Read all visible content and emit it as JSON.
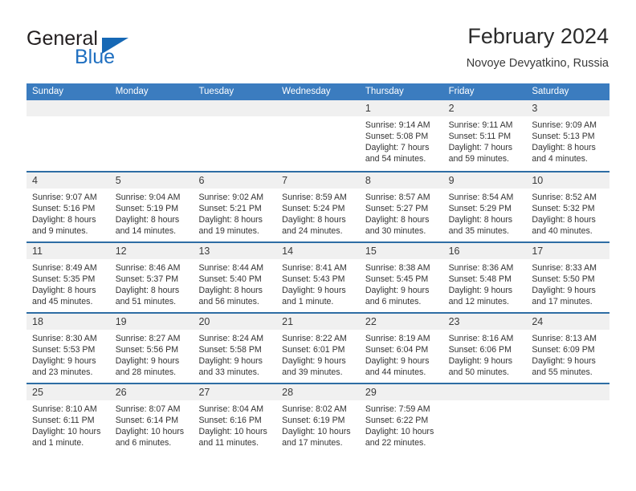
{
  "brand": {
    "word_one": "General",
    "word_two": "Blue",
    "triangle_color": "#1668b5"
  },
  "header": {
    "title": "February 2024",
    "subtitle": "Novoye Devyatkino, Russia"
  },
  "theme": {
    "header_row_bg": "#3b7cbf",
    "row_divider": "#2e6da4",
    "day_band_bg": "#f0f0f0",
    "text": "#333333"
  },
  "weekdays": [
    "Sunday",
    "Monday",
    "Tuesday",
    "Wednesday",
    "Thursday",
    "Friday",
    "Saturday"
  ],
  "weeks": [
    [
      {
        "day": "",
        "lines": [
          "",
          "",
          "",
          ""
        ]
      },
      {
        "day": "",
        "lines": [
          "",
          "",
          "",
          ""
        ]
      },
      {
        "day": "",
        "lines": [
          "",
          "",
          "",
          ""
        ]
      },
      {
        "day": "",
        "lines": [
          "",
          "",
          "",
          ""
        ]
      },
      {
        "day": "1",
        "lines": [
          "Sunrise: 9:14 AM",
          "Sunset: 5:08 PM",
          "Daylight: 7 hours",
          "and 54 minutes."
        ]
      },
      {
        "day": "2",
        "lines": [
          "Sunrise: 9:11 AM",
          "Sunset: 5:11 PM",
          "Daylight: 7 hours",
          "and 59 minutes."
        ]
      },
      {
        "day": "3",
        "lines": [
          "Sunrise: 9:09 AM",
          "Sunset: 5:13 PM",
          "Daylight: 8 hours",
          "and 4 minutes."
        ]
      }
    ],
    [
      {
        "day": "4",
        "lines": [
          "Sunrise: 9:07 AM",
          "Sunset: 5:16 PM",
          "Daylight: 8 hours",
          "and 9 minutes."
        ]
      },
      {
        "day": "5",
        "lines": [
          "Sunrise: 9:04 AM",
          "Sunset: 5:19 PM",
          "Daylight: 8 hours",
          "and 14 minutes."
        ]
      },
      {
        "day": "6",
        "lines": [
          "Sunrise: 9:02 AM",
          "Sunset: 5:21 PM",
          "Daylight: 8 hours",
          "and 19 minutes."
        ]
      },
      {
        "day": "7",
        "lines": [
          "Sunrise: 8:59 AM",
          "Sunset: 5:24 PM",
          "Daylight: 8 hours",
          "and 24 minutes."
        ]
      },
      {
        "day": "8",
        "lines": [
          "Sunrise: 8:57 AM",
          "Sunset: 5:27 PM",
          "Daylight: 8 hours",
          "and 30 minutes."
        ]
      },
      {
        "day": "9",
        "lines": [
          "Sunrise: 8:54 AM",
          "Sunset: 5:29 PM",
          "Daylight: 8 hours",
          "and 35 minutes."
        ]
      },
      {
        "day": "10",
        "lines": [
          "Sunrise: 8:52 AM",
          "Sunset: 5:32 PM",
          "Daylight: 8 hours",
          "and 40 minutes."
        ]
      }
    ],
    [
      {
        "day": "11",
        "lines": [
          "Sunrise: 8:49 AM",
          "Sunset: 5:35 PM",
          "Daylight: 8 hours",
          "and 45 minutes."
        ]
      },
      {
        "day": "12",
        "lines": [
          "Sunrise: 8:46 AM",
          "Sunset: 5:37 PM",
          "Daylight: 8 hours",
          "and 51 minutes."
        ]
      },
      {
        "day": "13",
        "lines": [
          "Sunrise: 8:44 AM",
          "Sunset: 5:40 PM",
          "Daylight: 8 hours",
          "and 56 minutes."
        ]
      },
      {
        "day": "14",
        "lines": [
          "Sunrise: 8:41 AM",
          "Sunset: 5:43 PM",
          "Daylight: 9 hours",
          "and 1 minute."
        ]
      },
      {
        "day": "15",
        "lines": [
          "Sunrise: 8:38 AM",
          "Sunset: 5:45 PM",
          "Daylight: 9 hours",
          "and 6 minutes."
        ]
      },
      {
        "day": "16",
        "lines": [
          "Sunrise: 8:36 AM",
          "Sunset: 5:48 PM",
          "Daylight: 9 hours",
          "and 12 minutes."
        ]
      },
      {
        "day": "17",
        "lines": [
          "Sunrise: 8:33 AM",
          "Sunset: 5:50 PM",
          "Daylight: 9 hours",
          "and 17 minutes."
        ]
      }
    ],
    [
      {
        "day": "18",
        "lines": [
          "Sunrise: 8:30 AM",
          "Sunset: 5:53 PM",
          "Daylight: 9 hours",
          "and 23 minutes."
        ]
      },
      {
        "day": "19",
        "lines": [
          "Sunrise: 8:27 AM",
          "Sunset: 5:56 PM",
          "Daylight: 9 hours",
          "and 28 minutes."
        ]
      },
      {
        "day": "20",
        "lines": [
          "Sunrise: 8:24 AM",
          "Sunset: 5:58 PM",
          "Daylight: 9 hours",
          "and 33 minutes."
        ]
      },
      {
        "day": "21",
        "lines": [
          "Sunrise: 8:22 AM",
          "Sunset: 6:01 PM",
          "Daylight: 9 hours",
          "and 39 minutes."
        ]
      },
      {
        "day": "22",
        "lines": [
          "Sunrise: 8:19 AM",
          "Sunset: 6:04 PM",
          "Daylight: 9 hours",
          "and 44 minutes."
        ]
      },
      {
        "day": "23",
        "lines": [
          "Sunrise: 8:16 AM",
          "Sunset: 6:06 PM",
          "Daylight: 9 hours",
          "and 50 minutes."
        ]
      },
      {
        "day": "24",
        "lines": [
          "Sunrise: 8:13 AM",
          "Sunset: 6:09 PM",
          "Daylight: 9 hours",
          "and 55 minutes."
        ]
      }
    ],
    [
      {
        "day": "25",
        "lines": [
          "Sunrise: 8:10 AM",
          "Sunset: 6:11 PM",
          "Daylight: 10 hours",
          "and 1 minute."
        ]
      },
      {
        "day": "26",
        "lines": [
          "Sunrise: 8:07 AM",
          "Sunset: 6:14 PM",
          "Daylight: 10 hours",
          "and 6 minutes."
        ]
      },
      {
        "day": "27",
        "lines": [
          "Sunrise: 8:04 AM",
          "Sunset: 6:16 PM",
          "Daylight: 10 hours",
          "and 11 minutes."
        ]
      },
      {
        "day": "28",
        "lines": [
          "Sunrise: 8:02 AM",
          "Sunset: 6:19 PM",
          "Daylight: 10 hours",
          "and 17 minutes."
        ]
      },
      {
        "day": "29",
        "lines": [
          "Sunrise: 7:59 AM",
          "Sunset: 6:22 PM",
          "Daylight: 10 hours",
          "and 22 minutes."
        ]
      },
      {
        "day": "",
        "lines": [
          "",
          "",
          "",
          ""
        ]
      },
      {
        "day": "",
        "lines": [
          "",
          "",
          "",
          ""
        ]
      }
    ]
  ]
}
